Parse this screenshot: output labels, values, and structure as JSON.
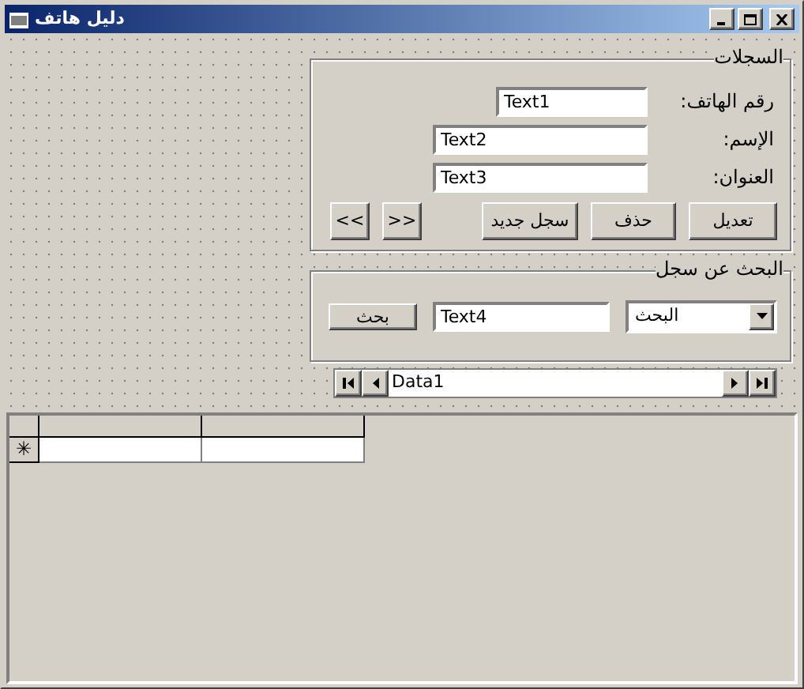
{
  "window": {
    "title": "دليل هاتف"
  },
  "records_frame": {
    "title": "السجلات",
    "fields": [
      {
        "label": "رقم الهاتف:",
        "value": "Text1"
      },
      {
        "label": "الإسم:",
        "value": "Text2"
      },
      {
        "label": "العنوان:",
        "value": "Text3"
      }
    ],
    "buttons": [
      "تعديل",
      "حذف",
      "سجل جديد",
      ">>",
      "<<"
    ]
  },
  "search_frame": {
    "title": "البحث عن سجل",
    "combo": {
      "value": "البحث"
    },
    "search_field": {
      "value": "Text4"
    },
    "button": "بحث"
  },
  "data_control": {
    "caption": "Data1"
  },
  "grid": {
    "new_row_marker": "✳"
  }
}
